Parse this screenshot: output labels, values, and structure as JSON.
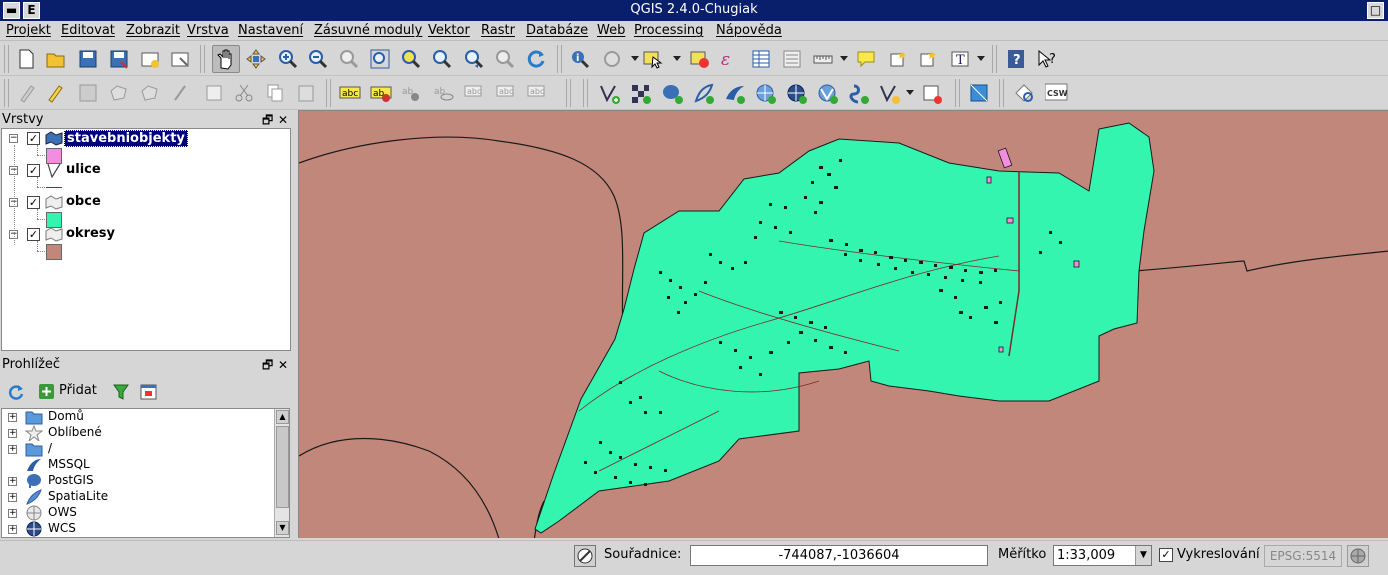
{
  "window": {
    "title": "QGIS 2.4.0-Chugiak",
    "btn_menu": "E"
  },
  "menu": [
    "Projekt",
    "Editovat",
    "Zobrazit",
    "Vrstva",
    "Nastavení",
    "Zásuvné moduly",
    "Vektor",
    "Rastr",
    "Databáze",
    "Web",
    "Processing",
    "Nápověda"
  ],
  "layers_panel": {
    "title": "Vrstvy",
    "layers": [
      {
        "name": "stavebniobjekty",
        "checked": true,
        "selected": true,
        "legend_color": "#f28ee0"
      },
      {
        "name": "ulice",
        "checked": true,
        "selected": false,
        "legend_color": "#8b2b2b"
      },
      {
        "name": "obce",
        "checked": true,
        "selected": false,
        "legend_color": "#33f5b0"
      },
      {
        "name": "okresy",
        "checked": true,
        "selected": false,
        "legend_color": "#c2877b"
      }
    ]
  },
  "browser_panel": {
    "title": "Prohlížeč",
    "add_label": "Přidat",
    "items": [
      {
        "label": "Domů",
        "icon": "folder-icon"
      },
      {
        "label": "Oblíbené",
        "icon": "star-icon"
      },
      {
        "label": "/",
        "icon": "folder-icon"
      },
      {
        "label": "MSSQL",
        "icon": "mssql-icon"
      },
      {
        "label": "PostGIS",
        "icon": "postgis-elephant-icon"
      },
      {
        "label": "SpatiaLite",
        "icon": "spatialite-feather-icon"
      },
      {
        "label": "OWS",
        "icon": "globe-icon"
      },
      {
        "label": "WCS",
        "icon": "wcs-globe-icon"
      }
    ]
  },
  "status": {
    "coord_label": "Souřadnice:",
    "coord_value": "-744087,-1036604",
    "scale_label": "Měřítko",
    "scale_value": "1:33,009",
    "render_label": "Vykreslování",
    "render_checked": true,
    "crs": "EPSG:5514"
  },
  "map": {
    "background": "#c2877b",
    "municipality_fill": "#33f5b0",
    "building_fill": "#f28ee0"
  }
}
